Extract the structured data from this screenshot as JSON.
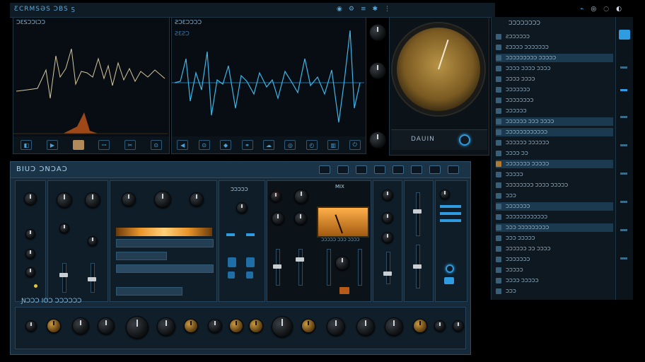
{
  "app": {
    "title": "ƸCRMSƏS ƆBS ƽ",
    "toolbar_icons": [
      "record-icon",
      "gear-icon",
      "mixer-icon",
      "settings-icon",
      "menu-icon"
    ],
    "window_controls": [
      "wifi-icon",
      "user-icon",
      "help-icon",
      "close-icon"
    ]
  },
  "scopes": {
    "left": {
      "label": "ƆƐSƆƆƖƆƆ"
    },
    "right": {
      "label": "ƧƆƐƆƆƆƆ",
      "sub": "ƧƐƧƆ"
    }
  },
  "meter_panel": {
    "logo_text": "DAUIN"
  },
  "browser": {
    "header": "ƆƆƆƆƆƆƆƆ",
    "items": [
      {
        "label": "ƧƆƆƆƆƆƆ",
        "selected": false,
        "accent": false
      },
      {
        "label": "ƧƆƆƆƆ ƆƆƆƆƆƆƆ",
        "selected": false,
        "accent": false
      },
      {
        "label": "ƆƆƆƆƆƆƆƆƆ ƆƆƆƆƆ",
        "selected": true,
        "accent": false
      },
      {
        "label": "ƆƆƆƆ ƆƆƆƆ ƆƆƆƆ",
        "selected": false,
        "accent": false
      },
      {
        "label": "ƆƆƆƆ ƆƆƆƆ",
        "selected": false,
        "accent": false
      },
      {
        "label": "ƆƆƆƆƆƆƆ",
        "selected": false,
        "accent": false
      },
      {
        "label": "ƆƆƆƆƆƆƆƆ",
        "selected": false,
        "accent": false
      },
      {
        "label": "ƆƆƆƆƆƆ",
        "selected": false,
        "accent": false
      },
      {
        "label": "ƆƆƆƆƆƆ ƆƆƆ ƆƆƆƆ",
        "selected": true,
        "accent": false
      },
      {
        "label": "ƆƆƆƆƆƆƆƆƆƆƆƆ",
        "selected": true,
        "accent": false
      },
      {
        "label": "ƆƆƆƆƆƆ ƆƆƆƆƆƆ",
        "selected": false,
        "accent": false
      },
      {
        "label": "ƆƆƆƆ ƆƆ",
        "selected": false,
        "accent": false
      },
      {
        "label": "ƆƆƆƆƆƆƆ ƆƆƆƆƆ",
        "selected": true,
        "accent": true
      },
      {
        "label": "ƆƆƆƆƆ",
        "selected": false,
        "accent": false
      },
      {
        "label": "ƆƆƆƆƆƆƆƆ ƆƆƆƆ ƆƆƆƆƆ",
        "selected": false,
        "accent": false
      },
      {
        "label": "ƆƆƆ",
        "selected": false,
        "accent": false
      },
      {
        "label": "ƆƆƆƆƆƆƆ",
        "selected": true,
        "accent": false
      },
      {
        "label": "ƆƆƆƆƆƆƆƆƆƆƆƆ",
        "selected": false,
        "accent": false
      },
      {
        "label": "ƆƆƆ ƆƆƆƆƆƆƆƆƆ",
        "selected": true,
        "accent": false
      },
      {
        "label": "ƆƆƆ ƆƆƆƆƆ",
        "selected": false,
        "accent": false
      },
      {
        "label": "ƆƆƆƆƆƆ ƆƆ ƆƆƆƆ",
        "selected": false,
        "accent": false
      },
      {
        "label": "ƆƆƆƆƆƆƆ",
        "selected": false,
        "accent": false
      },
      {
        "label": "ƆƆƆƆƆ",
        "selected": false,
        "accent": false
      },
      {
        "label": "ƆƆƆƆ ƆƆƆƆƆ",
        "selected": false,
        "accent": false
      },
      {
        "label": "ƆƆƆ",
        "selected": false,
        "accent": false
      }
    ]
  },
  "mixer": {
    "title": "BIUƆ ƆNƆAƆ",
    "section_label": "ƆƆƆƆƆ",
    "mix_label": "MIX",
    "bottom_title": "ƝƆƆƆ IOƆ ƆƆƆƆƆƆ",
    "vu_caption": "ƆƆƆƆƆ ƆƆƆ ƆƆƆƆ"
  },
  "colors": {
    "accent": "#2f9be0",
    "panel": "#162a39",
    "orange": "#e9952a",
    "background": "#000000"
  }
}
